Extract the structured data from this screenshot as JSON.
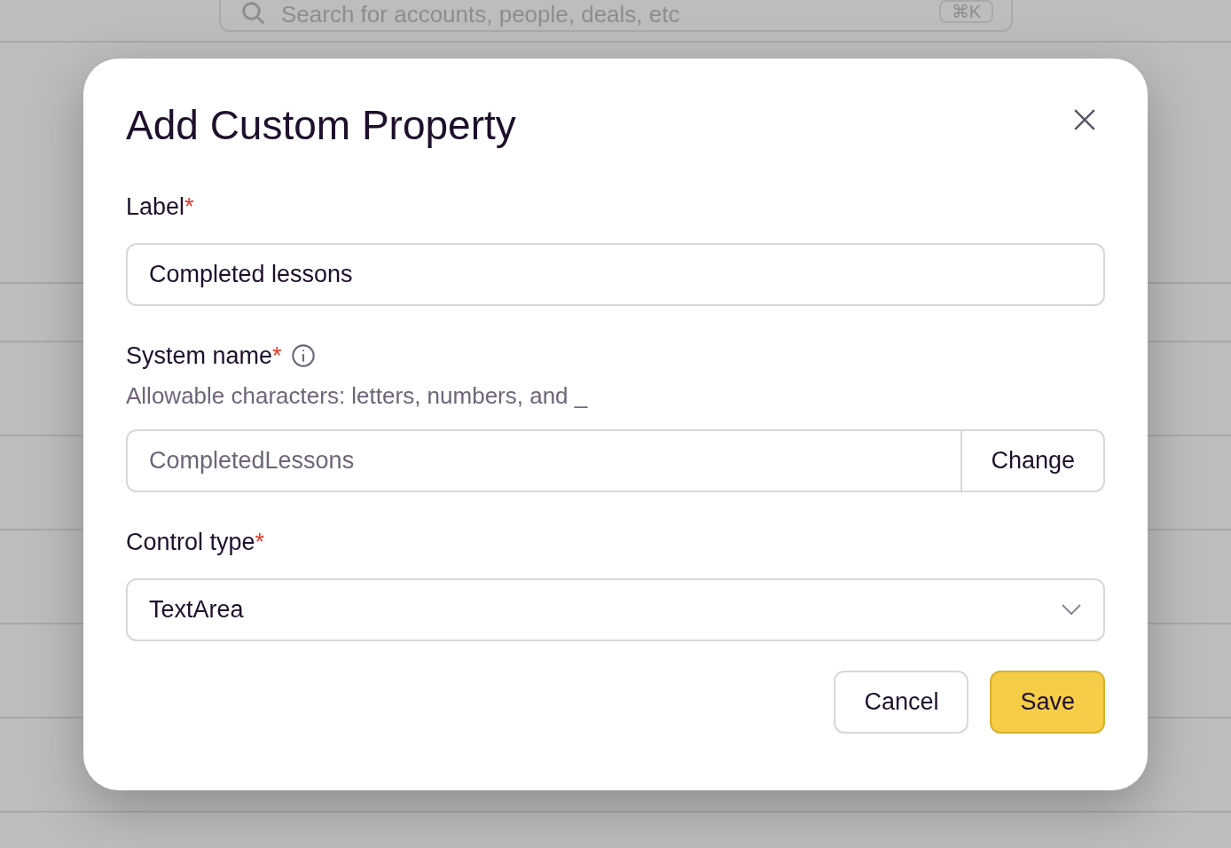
{
  "background": {
    "search": {
      "placeholder": "Search for accounts, people, deals, etc",
      "shortcut": "⌘K"
    }
  },
  "dialog": {
    "title": "Add Custom Property",
    "fields": [
      {
        "kind": "text",
        "label": "Label",
        "required_mark": "*",
        "value": "Completed lessons"
      },
      {
        "kind": "addon",
        "label": "System name",
        "required_mark": "*",
        "info": true,
        "hint": "Allowable characters: letters, numbers, and _",
        "value": "CompletedLessons",
        "readonly": true,
        "button": "Change"
      },
      {
        "kind": "select",
        "label": "Control type",
        "required_mark": "*",
        "value": "TextArea"
      }
    ],
    "buttons": [
      {
        "label": "Cancel",
        "kind": "secondary"
      },
      {
        "label": "Save",
        "kind": "primary"
      }
    ]
  }
}
